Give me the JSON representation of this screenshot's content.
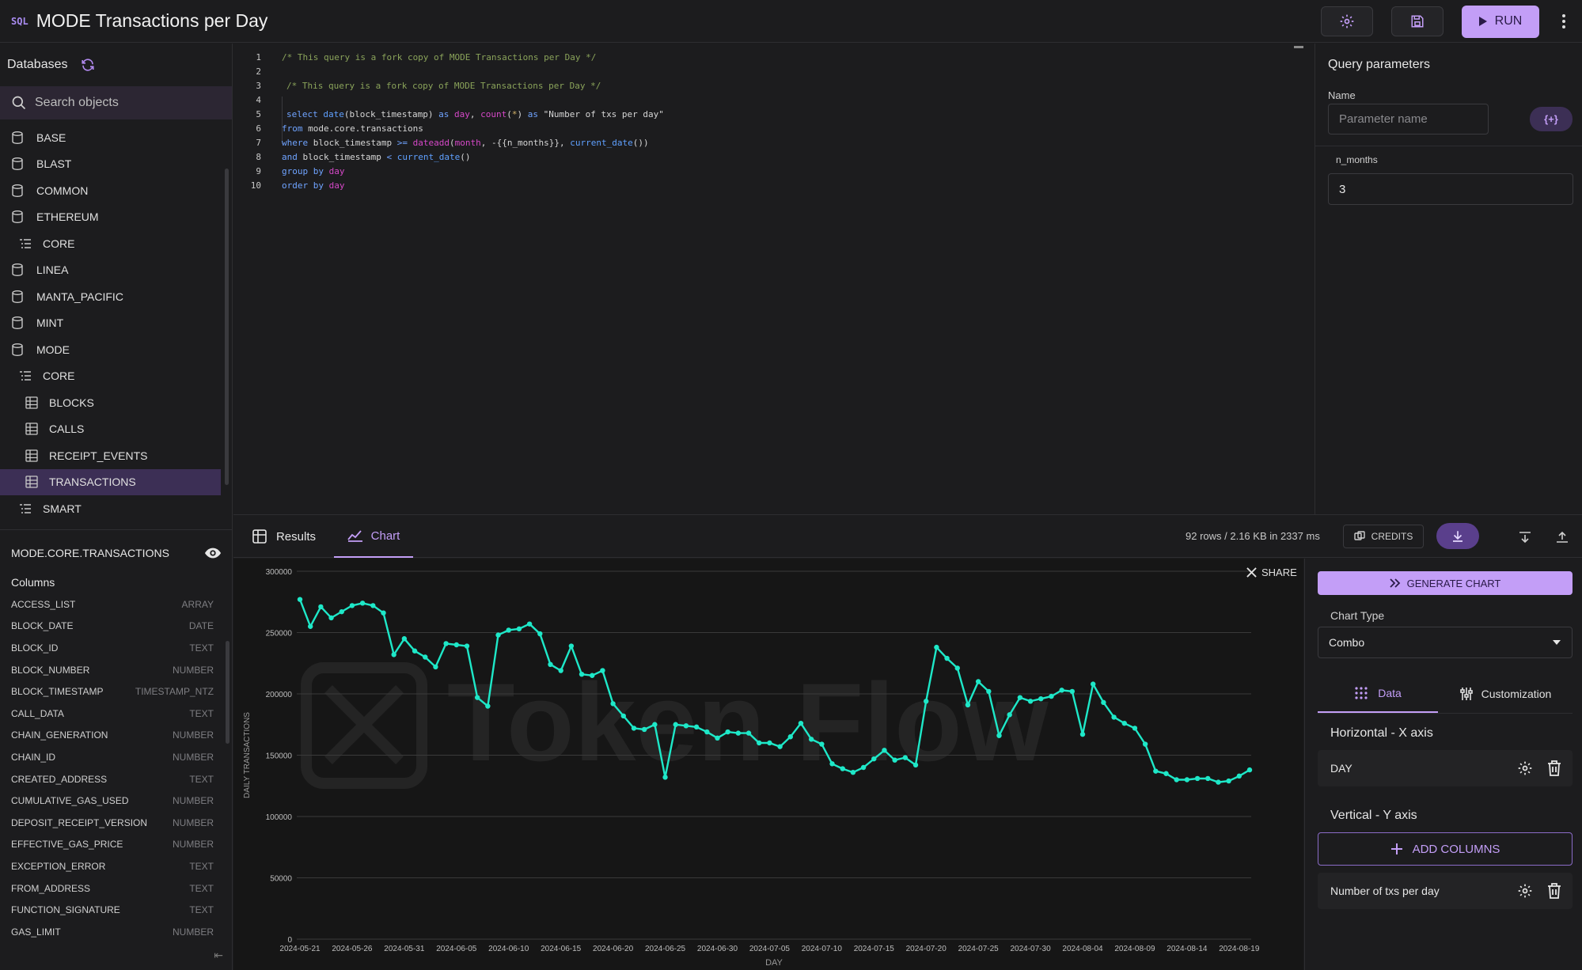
{
  "header": {
    "sql_badge": "SQL",
    "title": "MODE Transactions per Day",
    "run_label": "RUN"
  },
  "sidebar": {
    "title": "Databases",
    "search_placeholder": "Search objects",
    "items": [
      {
        "label": "BASE",
        "type": "database"
      },
      {
        "label": "BLAST",
        "type": "database"
      },
      {
        "label": "COMMON",
        "type": "database"
      },
      {
        "label": "ETHEREUM",
        "type": "database"
      },
      {
        "label": "CORE",
        "type": "schema"
      },
      {
        "label": "LINEA",
        "type": "database"
      },
      {
        "label": "MANTA_PACIFIC",
        "type": "database"
      },
      {
        "label": "MINT",
        "type": "database"
      },
      {
        "label": "MODE",
        "type": "database"
      },
      {
        "label": "CORE",
        "type": "schema"
      },
      {
        "label": "BLOCKS",
        "type": "table"
      },
      {
        "label": "CALLS",
        "type": "table"
      },
      {
        "label": "RECEIPT_EVENTS",
        "type": "table"
      },
      {
        "label": "TRANSACTIONS",
        "type": "table",
        "selected": true
      },
      {
        "label": "SMART",
        "type": "schema"
      }
    ],
    "table": {
      "name": "MODE.CORE.TRANSACTIONS",
      "columns_label": "Columns",
      "columns": [
        {
          "name": "ACCESS_LIST",
          "type": "ARRAY"
        },
        {
          "name": "BLOCK_DATE",
          "type": "DATE"
        },
        {
          "name": "BLOCK_ID",
          "type": "TEXT"
        },
        {
          "name": "BLOCK_NUMBER",
          "type": "NUMBER"
        },
        {
          "name": "BLOCK_TIMESTAMP",
          "type": "TIMESTAMP_NTZ"
        },
        {
          "name": "CALL_DATA",
          "type": "TEXT"
        },
        {
          "name": "CHAIN_GENERATION",
          "type": "NUMBER"
        },
        {
          "name": "CHAIN_ID",
          "type": "NUMBER"
        },
        {
          "name": "CREATED_ADDRESS",
          "type": "TEXT"
        },
        {
          "name": "CUMULATIVE_GAS_USED",
          "type": "NUMBER"
        },
        {
          "name": "DEPOSIT_RECEIPT_VERSION",
          "type": "NUMBER"
        },
        {
          "name": "EFFECTIVE_GAS_PRICE",
          "type": "NUMBER"
        },
        {
          "name": "EXCEPTION_ERROR",
          "type": "TEXT"
        },
        {
          "name": "FROM_ADDRESS",
          "type": "TEXT"
        },
        {
          "name": "FUNCTION_SIGNATURE",
          "type": "TEXT"
        },
        {
          "name": "GAS_LIMIT",
          "type": "NUMBER"
        }
      ]
    }
  },
  "editor": {
    "line_numbers": [
      "1",
      "2",
      "3",
      "4",
      "5",
      "6",
      "7",
      "8",
      "9",
      "10"
    ]
  },
  "params": {
    "title": "Query parameters",
    "name_label": "Name",
    "name_placeholder": "Parameter name",
    "add_label": "{+}",
    "param_name": "n_months",
    "param_value": "3"
  },
  "results": {
    "tab_results": "Results",
    "tab_chart": "Chart",
    "rows_info": "92 rows / 2.16 KB in 2337 ms",
    "credits_label": "CREDITS"
  },
  "chart_panel": {
    "share_label": "SHARE",
    "generate_label": "GENERATE CHART",
    "chart_type_label": "Chart Type",
    "chart_type_value": "Combo",
    "tab_data": "Data",
    "tab_customization": "Customization",
    "x_axis_title": "Horizontal - X axis",
    "x_axis_field": "DAY",
    "y_axis_title": "Vertical - Y axis",
    "add_columns_label": "ADD COLUMNS",
    "y_axis_field": "Number of txs per day"
  },
  "chart_data": {
    "type": "line",
    "title": "",
    "xlabel": "DAY",
    "ylabel": "DAILY TRANSACTIONS",
    "ylim": [
      0,
      300000
    ],
    "y_ticks": [
      0,
      50000,
      100000,
      150000,
      200000,
      250000,
      300000
    ],
    "x_tick_labels": [
      "2024-05-21",
      "2024-05-26",
      "2024-05-31",
      "2024-06-05",
      "2024-06-10",
      "2024-06-15",
      "2024-06-20",
      "2024-06-25",
      "2024-06-30",
      "2024-07-05",
      "2024-07-10",
      "2024-07-15",
      "2024-07-20",
      "2024-07-25",
      "2024-07-30",
      "2024-08-04",
      "2024-08-09",
      "2024-08-14",
      "2024-08-19"
    ],
    "watermark": "Token Flow",
    "color": "#1ee8c8",
    "series": [
      {
        "values": [
          277000,
          255000,
          271000,
          262000,
          267000,
          272000,
          274000,
          272000,
          266000,
          232000,
          245000,
          235000,
          230000,
          222000,
          241000,
          240000,
          239000,
          197000,
          190000,
          248000,
          252000,
          253000,
          257000,
          249000,
          224000,
          219000,
          239000,
          216000,
          215000,
          219000,
          192000,
          182000,
          172000,
          171000,
          175000,
          132000,
          175000,
          174000,
          173000,
          169000,
          164000,
          169000,
          168000,
          168000,
          160000,
          160000,
          157000,
          165000,
          176000,
          163000,
          159000,
          143000,
          139000,
          136000,
          140000,
          147000,
          154000,
          146000,
          148000,
          142000,
          194000,
          238000,
          229000,
          221000,
          191000,
          210000,
          202000,
          166000,
          183000,
          197000,
          194000,
          196000,
          198000,
          203000,
          202000,
          167000,
          208000,
          193000,
          181000,
          176000,
          172000,
          159000,
          137000,
          135000,
          130000,
          130000,
          131000,
          131000,
          128000,
          129000,
          133000,
          138000
        ]
      }
    ]
  }
}
